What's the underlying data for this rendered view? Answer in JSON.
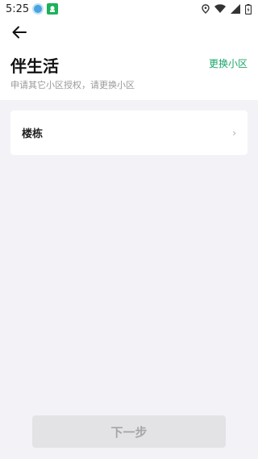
{
  "status_bar": {
    "time": "5:25",
    "icons": [
      "app-icon-blue",
      "app-icon-green",
      "location-icon",
      "wifi-icon",
      "signal-icon",
      "battery-icon"
    ]
  },
  "header": {
    "back_icon": "arrow-left-icon",
    "title": "伴生活",
    "change_link": "更换小区",
    "subtitle": "申请其它小区授权，请更换小区"
  },
  "form": {
    "building_label": "楼栋",
    "chevron": "›"
  },
  "footer": {
    "next_label": "下一步"
  },
  "colors": {
    "accent": "#1aa46a",
    "background": "#f3f3f7",
    "disabled_button": "#e3e3e6"
  }
}
